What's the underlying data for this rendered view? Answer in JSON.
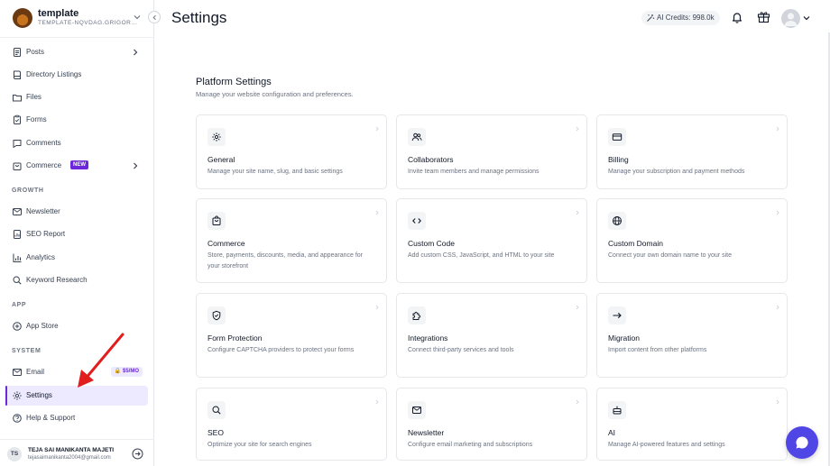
{
  "workspace": {
    "name": "template",
    "slug": "TEMPLATE-NQVDAG.GRIGOR..."
  },
  "sidebar": {
    "items_top": [
      {
        "label": "Posts",
        "icon": "document-icon",
        "has_arrow": true
      },
      {
        "label": "Directory Listings",
        "icon": "book-icon"
      },
      {
        "label": "Files",
        "icon": "folder-icon"
      },
      {
        "label": "Forms",
        "icon": "clipboard-icon"
      },
      {
        "label": "Comments",
        "icon": "comment-icon"
      },
      {
        "label": "Commerce",
        "icon": "shopping-bag-icon",
        "badge": "NEW",
        "has_arrow": true
      }
    ],
    "growth_label": "GROWTH",
    "growth_items": [
      {
        "label": "Newsletter",
        "icon": "mail-icon"
      },
      {
        "label": "SEO Report",
        "icon": "report-icon"
      },
      {
        "label": "Analytics",
        "icon": "bar-chart-icon"
      },
      {
        "label": "Keyword Research",
        "icon": "search-icon"
      }
    ],
    "app_label": "APP",
    "app_items": [
      {
        "label": "App Store",
        "icon": "app-store-icon"
      }
    ],
    "system_label": "SYSTEM",
    "system_items": [
      {
        "label": "Email",
        "icon": "mail-icon",
        "badge": "$5/MO"
      },
      {
        "label": "Settings",
        "icon": "gear-icon",
        "active": true
      },
      {
        "label": "Help & Support",
        "icon": "help-icon"
      }
    ]
  },
  "user": {
    "initials": "TS",
    "name": "TEJA SAI MANIKANTA MAJETI",
    "email": "tejasaimanikanta2004@gmail.com"
  },
  "header": {
    "title": "Settings",
    "credits": "AI Credits: 998.0k"
  },
  "content": {
    "section_title": "Platform Settings",
    "section_subtitle": "Manage your website configuration and preferences.",
    "cards": [
      {
        "title": "General",
        "desc": "Manage your site name, slug, and basic settings",
        "icon": "gear-icon"
      },
      {
        "title": "Collaborators",
        "desc": "Invite team members and manage permissions",
        "icon": "users-icon"
      },
      {
        "title": "Billing",
        "desc": "Manage your subscription and payment methods",
        "icon": "credit-card-icon"
      },
      {
        "title": "Commerce",
        "desc": "Store, payments, discounts, media, and appearance for your storefront",
        "icon": "shopping-bag-icon"
      },
      {
        "title": "Custom Code",
        "desc": "Add custom CSS, JavaScript, and HTML to your site",
        "icon": "code-icon"
      },
      {
        "title": "Custom Domain",
        "desc": "Connect your own domain name to your site",
        "icon": "globe-icon"
      },
      {
        "title": "Form Protection",
        "desc": "Configure CAPTCHA providers to protect your forms",
        "icon": "shield-check-icon"
      },
      {
        "title": "Integrations",
        "desc": "Connect third-party services and tools",
        "icon": "puzzle-icon"
      },
      {
        "title": "Migration",
        "desc": "Import content from other platforms",
        "icon": "arrow-right-icon"
      },
      {
        "title": "SEO",
        "desc": "Optimize your site for search engines",
        "icon": "search-icon"
      },
      {
        "title": "Newsletter",
        "desc": "Configure email marketing and subscriptions",
        "icon": "mail-icon"
      },
      {
        "title": "AI",
        "desc": "Manage AI-powered features and settings",
        "icon": "robot-icon"
      }
    ]
  },
  "colors": {
    "accent": "#6d28d9",
    "active_bg": "#ede9fe",
    "chat": "#4f46e5",
    "annotation_arrow": "#e11d1d"
  }
}
